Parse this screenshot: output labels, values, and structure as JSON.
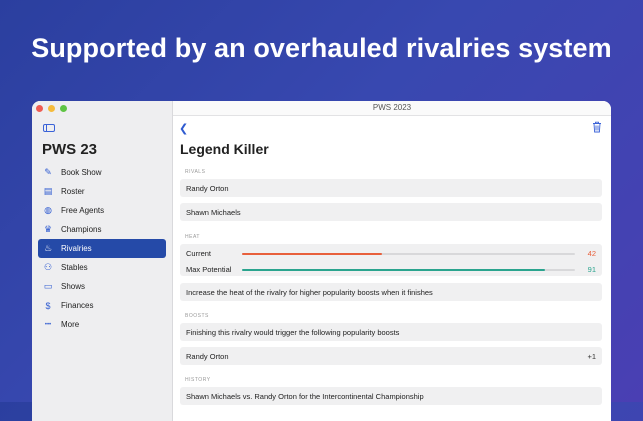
{
  "headline": "Supported by an overhauled rivalries system",
  "window": {
    "title": "PWS 2023"
  },
  "sidebar": {
    "app_title": "PWS 23",
    "items": [
      {
        "label": "Book Show",
        "icon": "edit-icon",
        "glyph": "✎"
      },
      {
        "label": "Roster",
        "icon": "id-card-icon",
        "glyph": "▤"
      },
      {
        "label": "Free Agents",
        "icon": "globe-icon",
        "glyph": "◍"
      },
      {
        "label": "Champions",
        "icon": "crown-icon",
        "glyph": "♛"
      },
      {
        "label": "Rivalries",
        "icon": "flame-icon",
        "glyph": "♨"
      },
      {
        "label": "Stables",
        "icon": "people-icon",
        "glyph": "⚇"
      },
      {
        "label": "Shows",
        "icon": "display-icon",
        "glyph": "▭"
      },
      {
        "label": "Finances",
        "icon": "dollar-icon",
        "glyph": "$"
      },
      {
        "label": "More",
        "icon": "ellipsis-icon",
        "glyph": "•••"
      }
    ],
    "active_index": 4
  },
  "main": {
    "title": "Legend Killer",
    "rivals_label": "RIVALS",
    "rivals": [
      "Randy Orton",
      "Shawn Michaels"
    ],
    "heat_label": "HEAT",
    "heat": [
      {
        "label": "Current",
        "value": "42",
        "fraction": 0.42,
        "color": "#e8603c"
      },
      {
        "label": "Max Potential",
        "value": "91",
        "fraction": 0.91,
        "color": "#2aa48e"
      }
    ],
    "heat_note": "Increase the heat of the rivalry for higher popularity boosts when it finishes",
    "boosts_label": "BOOSTS",
    "boosts_note": "Finishing this rivalry would trigger the following popularity boosts",
    "boost": {
      "name": "Randy Orton",
      "value": "+1"
    },
    "history_label": "HISTORY",
    "history": [
      "Shawn Michaels vs. Randy Orton for the Intercontinental Championship"
    ]
  }
}
